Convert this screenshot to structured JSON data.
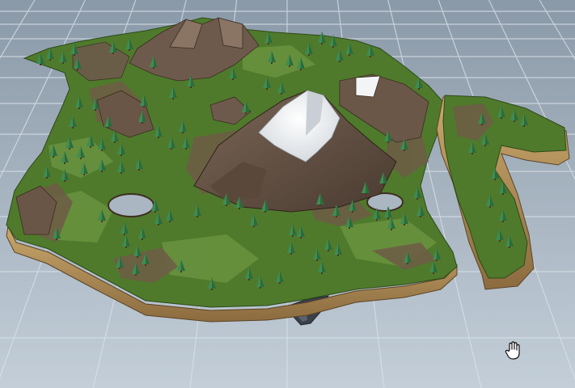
{
  "viewport": {
    "background_top": "#8a99a8",
    "background_bottom": "#bcc8d2",
    "grid_color": "#dbe3ea"
  },
  "scene": {
    "subject": "low-poly-island-terrain",
    "colors": {
      "grass": "#4f7a2c",
      "grass_light": "#6a9438",
      "dirt": "#6b5a4a",
      "rock": "#5e4a3c",
      "snow": "#f4f6f8",
      "side_cliff": "#b9965e",
      "side_shadow": "#8f6f42",
      "tree": "#3f8c52",
      "tree_dark": "#2d6b3c",
      "stalactite": "#3a4048"
    }
  },
  "cursor": {
    "icon": "hand-pan-icon"
  }
}
